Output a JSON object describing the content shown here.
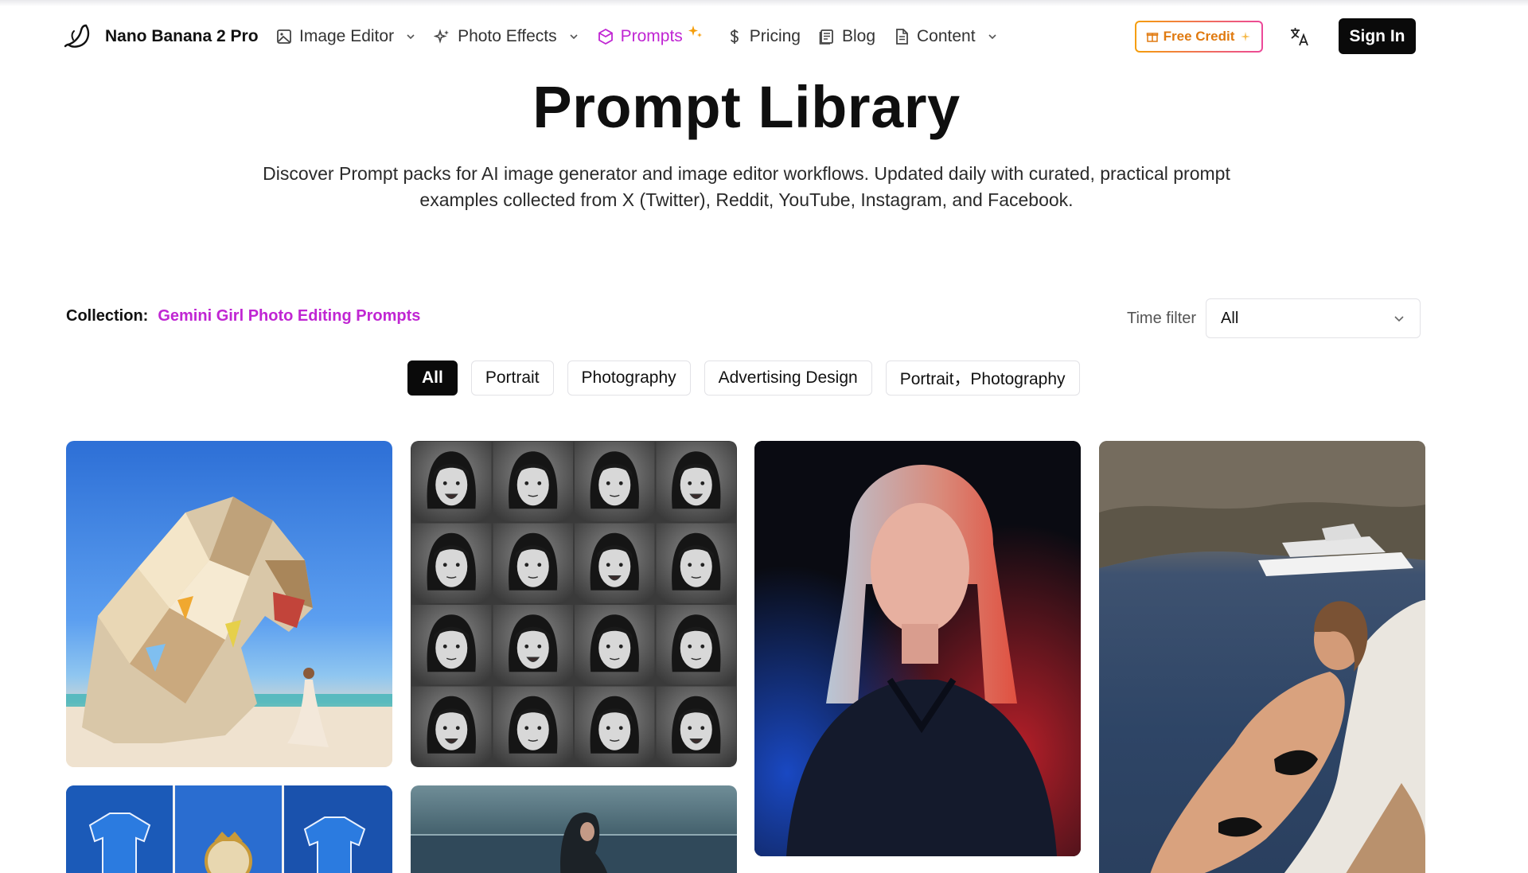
{
  "brand": {
    "name": "Nano Banana 2 Pro"
  },
  "nav": {
    "items": [
      {
        "label": "Image Editor",
        "icon": "image-icon",
        "dropdown": true
      },
      {
        "label": "Photo Effects",
        "icon": "sparkles-icon",
        "dropdown": true
      },
      {
        "label": "Prompts",
        "icon": "cube-icon",
        "active": true
      },
      {
        "label": "Pricing",
        "icon": "dollar-icon"
      },
      {
        "label": "Blog",
        "icon": "book-icon"
      },
      {
        "label": "Content",
        "icon": "document-icon",
        "dropdown": true
      }
    ]
  },
  "header": {
    "free_credit": "Free Credit",
    "translate_icon": "translate-icon",
    "sign_in": "Sign In"
  },
  "hero": {
    "title": "Prompt Library",
    "description": "Discover Prompt packs for AI image generator and image editor workflows. Updated daily with curated, practical prompt examples collected from X (Twitter), Reddit, YouTube, Instagram, and Facebook."
  },
  "collection": {
    "label": "Collection:",
    "value": "Gemini Girl Photo Editing Prompts"
  },
  "time_filter": {
    "label": "Time filter",
    "selected": "All"
  },
  "tags": [
    "All",
    "Portrait",
    "Photography",
    "Advertising Design",
    "Portrait，Photography"
  ],
  "colors": {
    "accent": "#c026d3",
    "credit_gradient": [
      "#f59e0b",
      "#ec4899"
    ],
    "button_dark": "#0a0a0a"
  }
}
